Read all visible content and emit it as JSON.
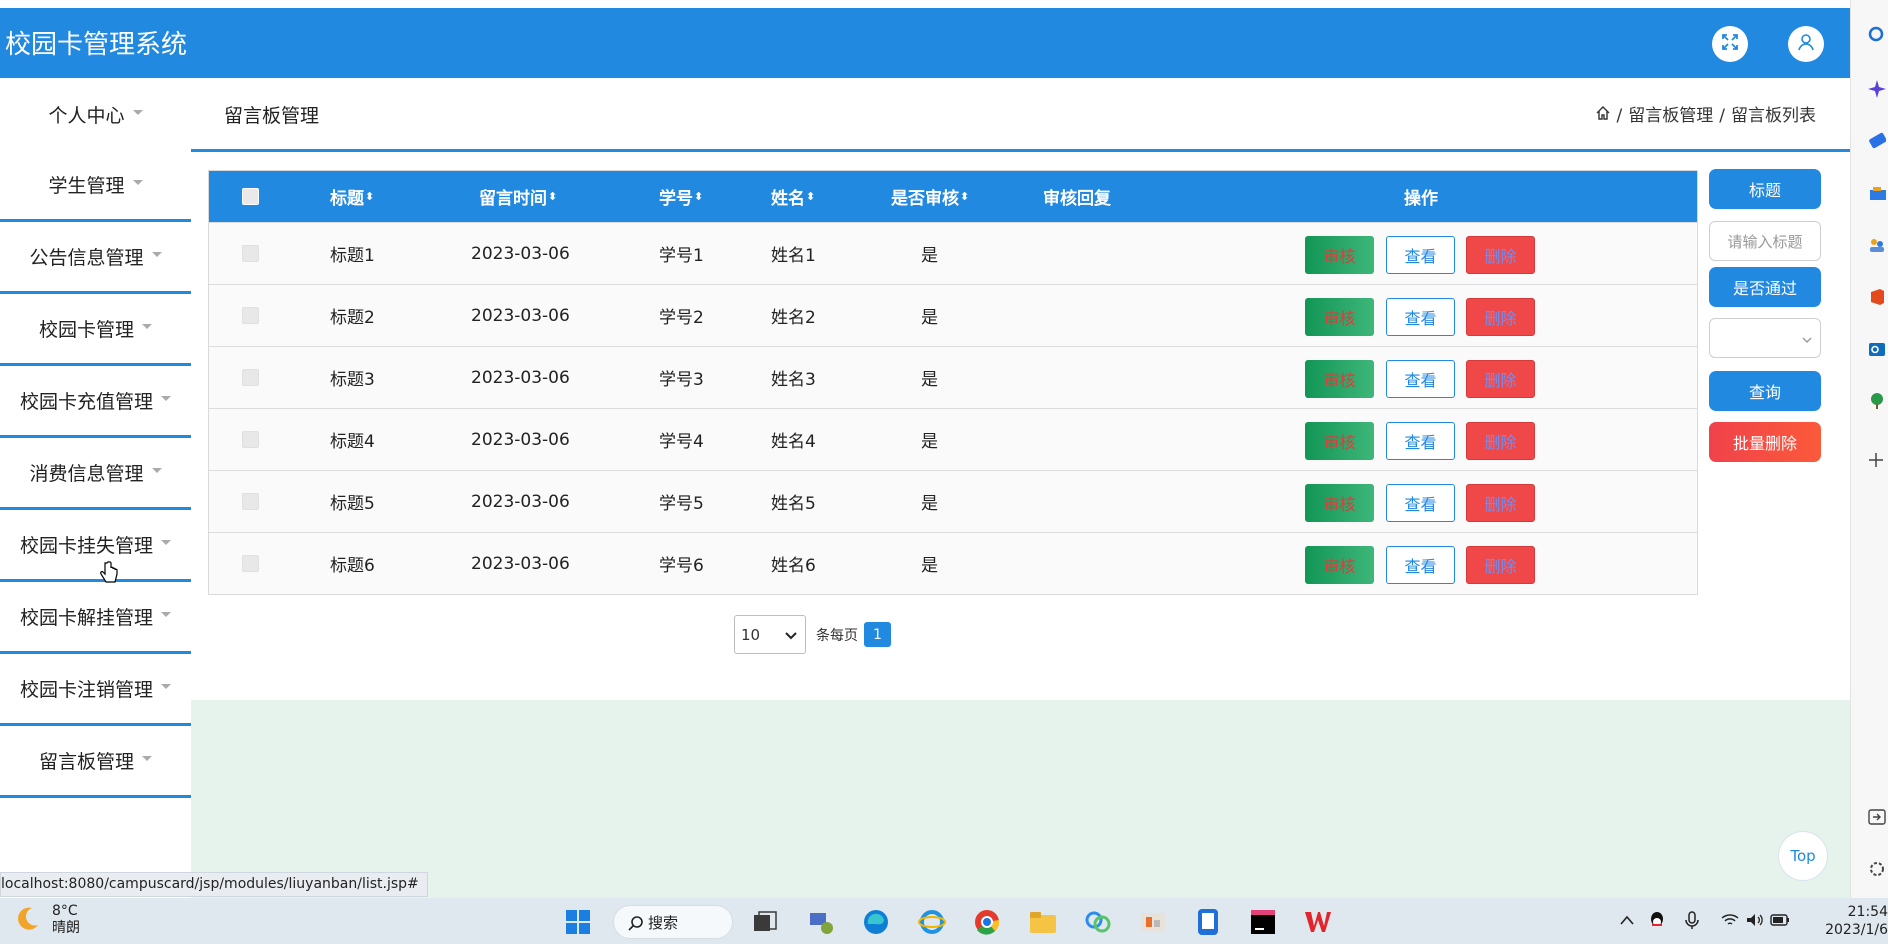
{
  "app": {
    "title": "校园卡管理系统"
  },
  "header": {
    "fullscreen_icon": "expand-icon",
    "user_icon": "user-icon"
  },
  "sidebar": {
    "items": [
      {
        "label": "个人中心"
      },
      {
        "label": "学生管理"
      },
      {
        "label": "公告信息管理"
      },
      {
        "label": "校园卡管理"
      },
      {
        "label": "校园卡充值管理"
      },
      {
        "label": "消费信息管理"
      },
      {
        "label": "校园卡挂失管理"
      },
      {
        "label": "校园卡解挂管理"
      },
      {
        "label": "校园卡注销管理"
      },
      {
        "label": "留言板管理"
      }
    ]
  },
  "page": {
    "title": "留言板管理",
    "breadcrumb": {
      "sep": "/",
      "level1": "留言板管理",
      "level2": "留言板列表"
    }
  },
  "table": {
    "headers": {
      "title": "标题",
      "time": "留言时间",
      "student_no": "学号",
      "name": "姓名",
      "approved": "是否审核",
      "reply": "审核回复",
      "actions": "操作"
    },
    "sort_glyph": "⬍",
    "rows": [
      {
        "title": "标题1",
        "time": "2023-03-06",
        "student_no": "学号1",
        "name": "姓名1",
        "approved": "是",
        "reply": ""
      },
      {
        "title": "标题2",
        "time": "2023-03-06",
        "student_no": "学号2",
        "name": "姓名2",
        "approved": "是",
        "reply": ""
      },
      {
        "title": "标题3",
        "time": "2023-03-06",
        "student_no": "学号3",
        "name": "姓名3",
        "approved": "是",
        "reply": ""
      },
      {
        "title": "标题4",
        "time": "2023-03-06",
        "student_no": "学号4",
        "name": "姓名4",
        "approved": "是",
        "reply": ""
      },
      {
        "title": "标题5",
        "time": "2023-03-06",
        "student_no": "学号5",
        "name": "姓名5",
        "approved": "是",
        "reply": ""
      },
      {
        "title": "标题6",
        "time": "2023-03-06",
        "student_no": "学号6",
        "name": "姓名6",
        "approved": "是",
        "reply": ""
      }
    ],
    "action_labels": {
      "approve": "审核",
      "view": "查看",
      "delete": "删除"
    }
  },
  "pagination": {
    "page_size": "10",
    "per_page_label": "条每页",
    "current_page": "1"
  },
  "search_panel": {
    "title_label": "标题",
    "title_placeholder": "请输入标题",
    "pass_label": "是否通过",
    "pass_value": "",
    "query_button": "查询",
    "batch_delete_button": "批量删除"
  },
  "back_to_top": "Top",
  "status_url": "localhost:8080/campuscard/jsp/modules/liuyanban/list.jsp#",
  "taskbar": {
    "weather_temp": "8°C",
    "weather_desc": "晴朗",
    "search_label": "搜索",
    "time": "21:54",
    "date": "2023/1/6"
  },
  "colors": {
    "primary": "#2289e1",
    "approve_green": "#129655",
    "delete_red": "#f04848",
    "panel_mint": "#e6f2ec"
  }
}
